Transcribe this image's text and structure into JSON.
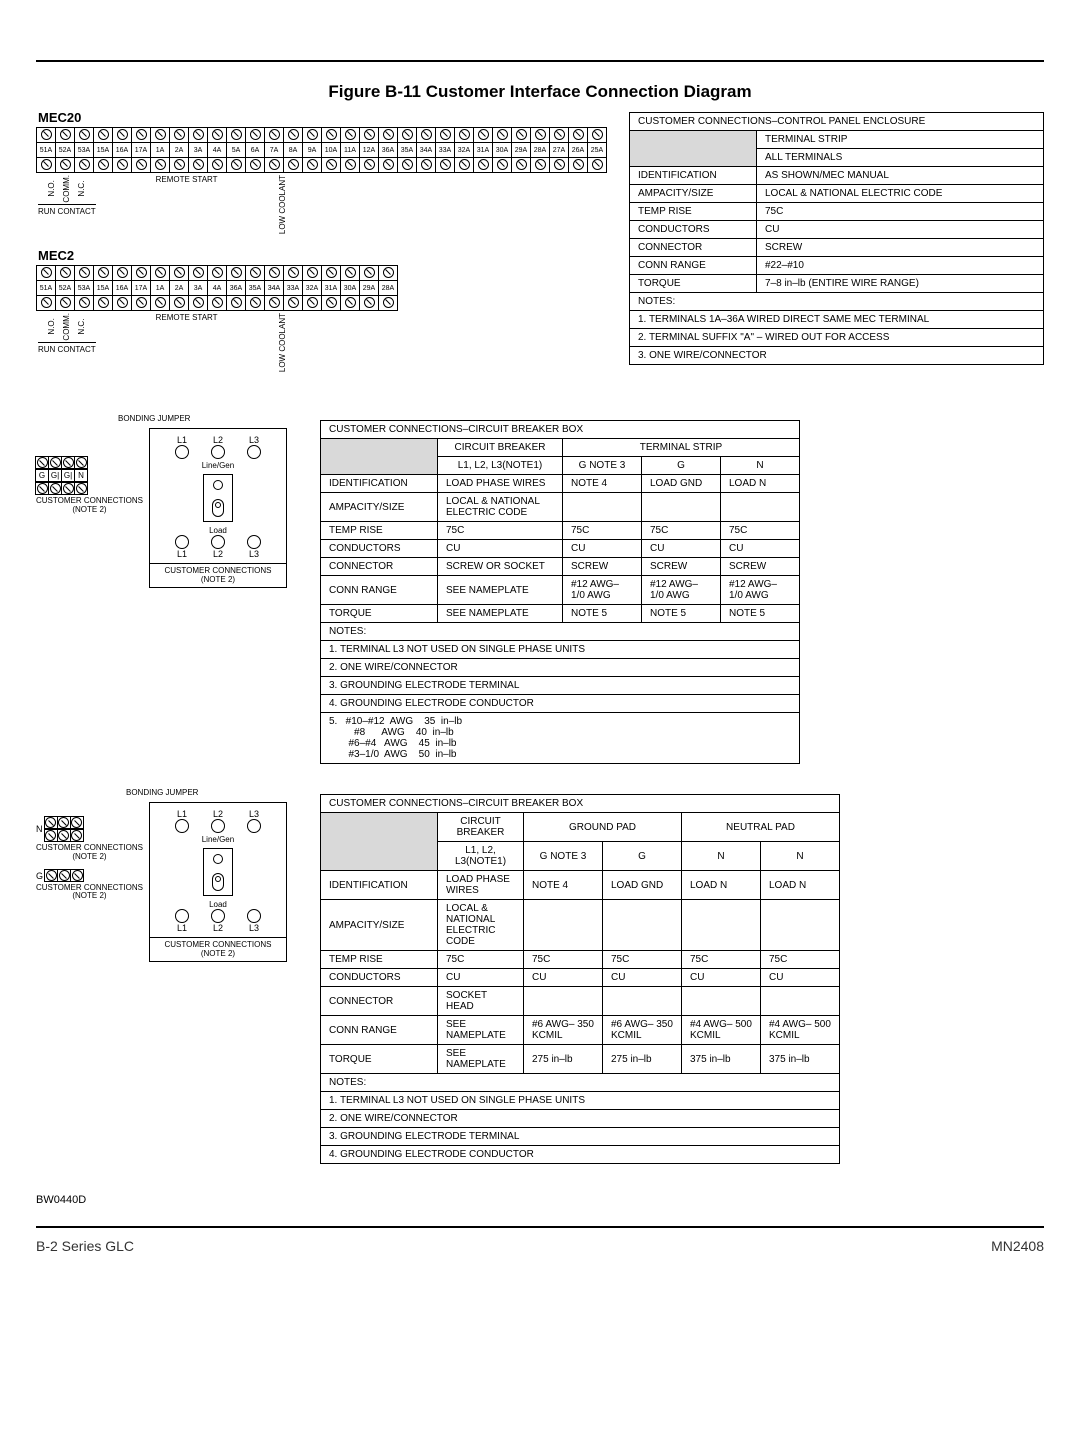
{
  "figure_title": "Figure B-11 Customer Interface Connection Diagram",
  "mec20_label": "MEC20",
  "mec2_label": "MEC2",
  "terminals_mec20": [
    "51A",
    "52A",
    "53A",
    "15A",
    "16A",
    "17A",
    "1A",
    "2A",
    "3A",
    "4A",
    "5A",
    "6A",
    "7A",
    "8A",
    "9A",
    "10A",
    "11A",
    "12A",
    "36A",
    "35A",
    "34A",
    "33A",
    "32A",
    "31A",
    "30A",
    "29A",
    "28A",
    "27A",
    "26A",
    "25A"
  ],
  "terminals_mec2": [
    "51A",
    "52A",
    "53A",
    "15A",
    "16A",
    "17A",
    "1A",
    "2A",
    "3A",
    "4A",
    "36A",
    "35A",
    "34A",
    "33A",
    "32A",
    "31A",
    "30A",
    "29A",
    "28A"
  ],
  "term_leg": {
    "no": "N.O.",
    "comm": "COMM.",
    "nc": "N.C.",
    "run_contact": "RUN CONTACT",
    "remote_start": "REMOTE START",
    "low_coolant": "LOW COOLANT"
  },
  "table1": {
    "title": "CUSTOMER CONNECTIONS–CONTROL PANEL ENCLOSURE",
    "col2a": "TERMINAL STRIP",
    "col2b": "ALL TERMINALS",
    "rows": [
      [
        "IDENTIFICATION",
        "AS SHOWN/MEC MANUAL"
      ],
      [
        "AMPACITY/SIZE",
        "LOCAL & NATIONAL ELECTRIC CODE"
      ],
      [
        "TEMP RISE",
        "75C"
      ],
      [
        "CONDUCTORS",
        "CU"
      ],
      [
        "CONNECTOR",
        "SCREW"
      ],
      [
        "CONN RANGE",
        "#22–#10"
      ],
      [
        "TORQUE",
        "7–8 in–lb (ENTIRE WIRE RANGE)"
      ]
    ],
    "notes_hdr": "NOTES:",
    "notes": [
      "1.  TERMINALS 1A–36A WIRED DIRECT SAME MEC TERMINAL",
      "2.  TERMINAL SUFFIX \"A\" – WIRED OUT FOR ACCESS",
      "3.  ONE WIRE/CONNECTOR"
    ]
  },
  "circuit": {
    "bonding": "BONDING JUMPER",
    "l1": "L1",
    "l2": "L2",
    "l3": "L3",
    "line_gen": "Line/Gen",
    "load": "Load",
    "g": "G",
    "gi": "G|",
    "n": "N",
    "cust_conn": "CUSTOMER CONNECTIONS",
    "note2": "(NOTE 2)"
  },
  "table2": {
    "title": "CUSTOMER CONNECTIONS–CIRCUIT BREAKER BOX",
    "h_cb": "CIRCUIT BREAKER",
    "h_ts": "TERMINAL STRIP",
    "sub_l": "L1, L2, L3(NOTE1)",
    "sub_g3": "G NOTE 3",
    "sub_g": "G",
    "sub_n": "N",
    "rows": [
      [
        "IDENTIFICATION",
        "LOAD PHASE WIRES",
        "NOTE 4",
        "LOAD GND",
        "LOAD N"
      ],
      [
        "AMPACITY/SIZE",
        "LOCAL & NATIONAL ELECTRIC CODE",
        "",
        "",
        ""
      ],
      [
        "TEMP RISE",
        "75C",
        "75C",
        "75C",
        "75C"
      ],
      [
        "CONDUCTORS",
        "CU",
        "CU",
        "CU",
        "CU"
      ],
      [
        "CONNECTOR",
        "SCREW OR SOCKET",
        "SCREW",
        "SCREW",
        "SCREW"
      ],
      [
        "CONN RANGE",
        "SEE NAMEPLATE",
        "#12 AWG– 1/0 AWG",
        "#12 AWG– 1/0 AWG",
        "#12 AWG– 1/0 AWG"
      ],
      [
        "TORQUE",
        "SEE NAMEPLATE",
        "NOTE 5",
        "NOTE 5",
        "NOTE 5"
      ]
    ],
    "notes_hdr": "NOTES:",
    "notes": [
      "1.   TERMINAL L3 NOT USED ON SINGLE PHASE UNITS",
      "2.   ONE WIRE/CONNECTOR",
      "3.   GROUNDING ELECTRODE TERMINAL",
      "4.   GROUNDING ELECTRODE CONDUCTOR"
    ],
    "note5": "5.   #10–#12  AWG    35  in–lb\n         #8      AWG    40  in–lb\n       #6–#4   AWG    45  in–lb\n       #3–1/0  AWG    50  in–lb"
  },
  "table3": {
    "title": "CUSTOMER CONNECTIONS–CIRCUIT BREAKER BOX",
    "h_cb": "CIRCUIT BREAKER",
    "h_gp": "GROUND PAD",
    "h_np": "NEUTRAL PAD",
    "sub_l": "L1, L2, L3(NOTE1)",
    "sub_g3": "G NOTE 3",
    "sub_g": "G",
    "sub_n1": "N",
    "sub_n2": "N",
    "rows": [
      [
        "IDENTIFICATION",
        "LOAD PHASE WIRES",
        "NOTE 4",
        "LOAD GND",
        "LOAD N",
        "LOAD N"
      ],
      [
        "AMPACITY/SIZE",
        "LOCAL & NATIONAL ELECTRIC CODE",
        "",
        "",
        "",
        ""
      ],
      [
        "TEMP RISE",
        "75C",
        "75C",
        "75C",
        "75C",
        "75C"
      ],
      [
        "CONDUCTORS",
        "CU",
        "CU",
        "CU",
        "CU",
        "CU"
      ],
      [
        "CONNECTOR",
        "SOCKET HEAD",
        "",
        "",
        "",
        ""
      ],
      [
        "CONN RANGE",
        "SEE NAMEPLATE",
        "#6 AWG– 350 KCMIL",
        "#6 AWG– 350 KCMIL",
        "#4 AWG– 500 KCMIL",
        "#4 AWG– 500 KCMIL"
      ],
      [
        "TORQUE",
        "SEE NAMEPLATE",
        "275 in–lb",
        "275 in–lb",
        "375 in–lb",
        "375 in–lb"
      ]
    ],
    "notes_hdr": "NOTES:",
    "notes": [
      "1.   TERMINAL L3 NOT USED ON SINGLE PHASE UNITS",
      "2.   ONE WIRE/CONNECTOR",
      "3.   GROUNDING ELECTRODE TERMINAL",
      "4.   GROUNDING ELECTRODE CONDUCTOR"
    ]
  },
  "drawing_num": "BW0440D",
  "footer_left": "B-2 Series GLC",
  "footer_right": "MN2408"
}
